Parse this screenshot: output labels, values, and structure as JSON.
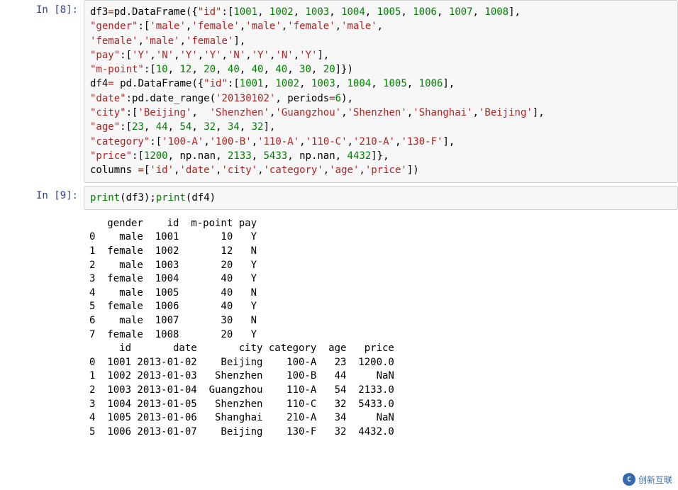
{
  "cells": [
    {
      "prompt": "In  [8]:",
      "code_tokens": [
        [
          "df3",
          "black"
        ],
        [
          "=",
          "op"
        ],
        [
          "pd",
          "black"
        ],
        [
          ".",
          "black"
        ],
        [
          "DataFrame",
          "black"
        ],
        [
          "({",
          "black"
        ],
        [
          "\"id\"",
          "str"
        ],
        [
          ":",
          "black"
        ],
        [
          "[",
          "black"
        ],
        [
          "1001",
          "num"
        ],
        [
          ", ",
          "black"
        ],
        [
          "1002",
          "num"
        ],
        [
          ", ",
          "black"
        ],
        [
          "1003",
          "num"
        ],
        [
          ", ",
          "black"
        ],
        [
          "1004",
          "num"
        ],
        [
          ", ",
          "black"
        ],
        [
          "1005",
          "num"
        ],
        [
          ", ",
          "black"
        ],
        [
          "1006",
          "num"
        ],
        [
          ", ",
          "black"
        ],
        [
          "1007",
          "num"
        ],
        [
          ", ",
          "black"
        ],
        [
          "1008",
          "num"
        ],
        [
          "],",
          "black"
        ],
        [
          "\n",
          "black"
        ],
        [
          "\"gender\"",
          "str"
        ],
        [
          ":",
          "black"
        ],
        [
          "[",
          "black"
        ],
        [
          "'male'",
          "str"
        ],
        [
          ",",
          "black"
        ],
        [
          "'female'",
          "str"
        ],
        [
          ",",
          "black"
        ],
        [
          "'male'",
          "str"
        ],
        [
          ",",
          "black"
        ],
        [
          "'female'",
          "str"
        ],
        [
          ",",
          "black"
        ],
        [
          "'male'",
          "str"
        ],
        [
          ",",
          "black"
        ],
        [
          "\n",
          "black"
        ],
        [
          "'female'",
          "str"
        ],
        [
          ",",
          "black"
        ],
        [
          "'male'",
          "str"
        ],
        [
          ",",
          "black"
        ],
        [
          "'female'",
          "str"
        ],
        [
          "],",
          "black"
        ],
        [
          "\n",
          "black"
        ],
        [
          "\"pay\"",
          "str"
        ],
        [
          ":",
          "black"
        ],
        [
          "[",
          "black"
        ],
        [
          "'Y'",
          "str"
        ],
        [
          ",",
          "black"
        ],
        [
          "'N'",
          "str"
        ],
        [
          ",",
          "black"
        ],
        [
          "'Y'",
          "str"
        ],
        [
          ",",
          "black"
        ],
        [
          "'Y'",
          "str"
        ],
        [
          ",",
          "black"
        ],
        [
          "'N'",
          "str"
        ],
        [
          ",",
          "black"
        ],
        [
          "'Y'",
          "str"
        ],
        [
          ",",
          "black"
        ],
        [
          "'N'",
          "str"
        ],
        [
          ",",
          "black"
        ],
        [
          "'Y'",
          "str"
        ],
        [
          "],",
          "black"
        ],
        [
          "\n",
          "black"
        ],
        [
          "\"m-point\"",
          "str"
        ],
        [
          ":",
          "black"
        ],
        [
          "[",
          "black"
        ],
        [
          "10",
          "num"
        ],
        [
          ", ",
          "black"
        ],
        [
          "12",
          "num"
        ],
        [
          ", ",
          "black"
        ],
        [
          "20",
          "num"
        ],
        [
          ", ",
          "black"
        ],
        [
          "40",
          "num"
        ],
        [
          ", ",
          "black"
        ],
        [
          "40",
          "num"
        ],
        [
          ", ",
          "black"
        ],
        [
          "40",
          "num"
        ],
        [
          ", ",
          "black"
        ],
        [
          "30",
          "num"
        ],
        [
          ", ",
          "black"
        ],
        [
          "20",
          "num"
        ],
        [
          "]})",
          "black"
        ],
        [
          "\n",
          "black"
        ],
        [
          "df4",
          "black"
        ],
        [
          "= ",
          "op"
        ],
        [
          "pd",
          "black"
        ],
        [
          ".",
          "black"
        ],
        [
          "DataFrame",
          "black"
        ],
        [
          "({",
          "black"
        ],
        [
          "\"id\"",
          "str"
        ],
        [
          ":",
          "black"
        ],
        [
          "[",
          "black"
        ],
        [
          "1001",
          "num"
        ],
        [
          ", ",
          "black"
        ],
        [
          "1002",
          "num"
        ],
        [
          ", ",
          "black"
        ],
        [
          "1003",
          "num"
        ],
        [
          ", ",
          "black"
        ],
        [
          "1004",
          "num"
        ],
        [
          ", ",
          "black"
        ],
        [
          "1005",
          "num"
        ],
        [
          ", ",
          "black"
        ],
        [
          "1006",
          "num"
        ],
        [
          "],",
          "black"
        ],
        [
          "\n",
          "black"
        ],
        [
          "\"date\"",
          "str"
        ],
        [
          ":",
          "black"
        ],
        [
          "pd",
          "black"
        ],
        [
          ".",
          "black"
        ],
        [
          "date_range",
          "black"
        ],
        [
          "(",
          "black"
        ],
        [
          "'20130102'",
          "str"
        ],
        [
          ", ",
          "black"
        ],
        [
          "periods",
          "black"
        ],
        [
          "=",
          "op"
        ],
        [
          "6",
          "num"
        ],
        [
          "),",
          "black"
        ],
        [
          "\n",
          "black"
        ],
        [
          "\"city\"",
          "str"
        ],
        [
          ":",
          "black"
        ],
        [
          "[",
          "black"
        ],
        [
          "'Beijing'",
          "str"
        ],
        [
          ",  ",
          "black"
        ],
        [
          "'Shenzhen'",
          "str"
        ],
        [
          ",",
          "black"
        ],
        [
          "'Guangzhou'",
          "str"
        ],
        [
          ",",
          "black"
        ],
        [
          "'Shenzhen'",
          "str"
        ],
        [
          ",",
          "black"
        ],
        [
          "'Shanghai'",
          "str"
        ],
        [
          ",",
          "black"
        ],
        [
          "'Beijing'",
          "str"
        ],
        [
          "],",
          "black"
        ],
        [
          "\n",
          "black"
        ],
        [
          "\"age\"",
          "str"
        ],
        [
          ":",
          "black"
        ],
        [
          "[",
          "black"
        ],
        [
          "23",
          "num"
        ],
        [
          ", ",
          "black"
        ],
        [
          "44",
          "num"
        ],
        [
          ", ",
          "black"
        ],
        [
          "54",
          "num"
        ],
        [
          ", ",
          "black"
        ],
        [
          "32",
          "num"
        ],
        [
          ", ",
          "black"
        ],
        [
          "34",
          "num"
        ],
        [
          ", ",
          "black"
        ],
        [
          "32",
          "num"
        ],
        [
          "],",
          "black"
        ],
        [
          "\n",
          "black"
        ],
        [
          "\"category\"",
          "str"
        ],
        [
          ":",
          "black"
        ],
        [
          "[",
          "black"
        ],
        [
          "'100-A'",
          "str"
        ],
        [
          ",",
          "black"
        ],
        [
          "'100-B'",
          "str"
        ],
        [
          ",",
          "black"
        ],
        [
          "'110-A'",
          "str"
        ],
        [
          ",",
          "black"
        ],
        [
          "'110-C'",
          "str"
        ],
        [
          ",",
          "black"
        ],
        [
          "'210-A'",
          "str"
        ],
        [
          ",",
          "black"
        ],
        [
          "'130-F'",
          "str"
        ],
        [
          "],",
          "black"
        ],
        [
          "\n",
          "black"
        ],
        [
          "\"price\"",
          "str"
        ],
        [
          ":",
          "black"
        ],
        [
          "[",
          "black"
        ],
        [
          "1200",
          "num"
        ],
        [
          ", ",
          "black"
        ],
        [
          "np",
          "black"
        ],
        [
          ".",
          "black"
        ],
        [
          "nan",
          "black"
        ],
        [
          ", ",
          "black"
        ],
        [
          "2133",
          "num"
        ],
        [
          ", ",
          "black"
        ],
        [
          "5433",
          "num"
        ],
        [
          ", ",
          "black"
        ],
        [
          "np",
          "black"
        ],
        [
          ".",
          "black"
        ],
        [
          "nan",
          "black"
        ],
        [
          ", ",
          "black"
        ],
        [
          "4432",
          "num"
        ],
        [
          "]},",
          "black"
        ],
        [
          "\n",
          "black"
        ],
        [
          "columns ",
          "black"
        ],
        [
          "=",
          "op"
        ],
        [
          "[",
          "black"
        ],
        [
          "'id'",
          "str"
        ],
        [
          ",",
          "black"
        ],
        [
          "'date'",
          "str"
        ],
        [
          ",",
          "black"
        ],
        [
          "'city'",
          "str"
        ],
        [
          ",",
          "black"
        ],
        [
          "'category'",
          "str"
        ],
        [
          ",",
          "black"
        ],
        [
          "'age'",
          "str"
        ],
        [
          ",",
          "black"
        ],
        [
          "'price'",
          "str"
        ],
        [
          "])",
          "black"
        ]
      ]
    },
    {
      "prompt": "In  [9]:",
      "code_tokens": [
        [
          "print",
          "func"
        ],
        [
          "(",
          "black"
        ],
        [
          "df3",
          "black"
        ],
        [
          ")",
          "black"
        ],
        [
          ";",
          "black"
        ],
        [
          "print",
          "func"
        ],
        [
          "(",
          "black"
        ],
        [
          "df4",
          "black"
        ],
        [
          ")",
          "black"
        ]
      ],
      "output": "   gender    id  m-point pay\n0    male  1001       10   Y\n1  female  1002       12   N\n2    male  1003       20   Y\n3  female  1004       40   Y\n4    male  1005       40   N\n5  female  1006       40   Y\n6    male  1007       30   N\n7  female  1008       20   Y\n     id       date       city category  age   price\n0  1001 2013-01-02    Beijing    100-A   23  1200.0\n1  1002 2013-01-03   Shenzhen    100-B   44     NaN\n2  1003 2013-01-04  Guangzhou    110-A   54  2133.0\n3  1004 2013-01-05   Shenzhen    110-C   32  5433.0\n4  1005 2013-01-06   Shanghai    210-A   34     NaN\n5  1006 2013-01-07    Beijing    130-F   32  4432.0"
    }
  ],
  "watermark": {
    "text": "创新互联"
  },
  "chart_data": {
    "type": "table",
    "tables": [
      {
        "name": "df3",
        "columns": [
          "gender",
          "id",
          "m-point",
          "pay"
        ],
        "rows": [
          [
            "male",
            1001,
            10,
            "Y"
          ],
          [
            "female",
            1002,
            12,
            "N"
          ],
          [
            "male",
            1003,
            20,
            "Y"
          ],
          [
            "female",
            1004,
            40,
            "Y"
          ],
          [
            "male",
            1005,
            40,
            "N"
          ],
          [
            "female",
            1006,
            40,
            "Y"
          ],
          [
            "male",
            1007,
            30,
            "N"
          ],
          [
            "female",
            1008,
            20,
            "Y"
          ]
        ]
      },
      {
        "name": "df4",
        "columns": [
          "id",
          "date",
          "city",
          "category",
          "age",
          "price"
        ],
        "rows": [
          [
            1001,
            "2013-01-02",
            "Beijing",
            "100-A",
            23,
            1200.0
          ],
          [
            1002,
            "2013-01-03",
            "Shenzhen",
            "100-B",
            44,
            null
          ],
          [
            1003,
            "2013-01-04",
            "Guangzhou",
            "110-A",
            54,
            2133.0
          ],
          [
            1004,
            "2013-01-05",
            "Shenzhen",
            "110-C",
            32,
            5433.0
          ],
          [
            1005,
            "2013-01-06",
            "Shanghai",
            "210-A",
            34,
            null
          ],
          [
            1006,
            "2013-01-07",
            "Beijing",
            "130-F",
            32,
            4432.0
          ]
        ]
      }
    ]
  }
}
